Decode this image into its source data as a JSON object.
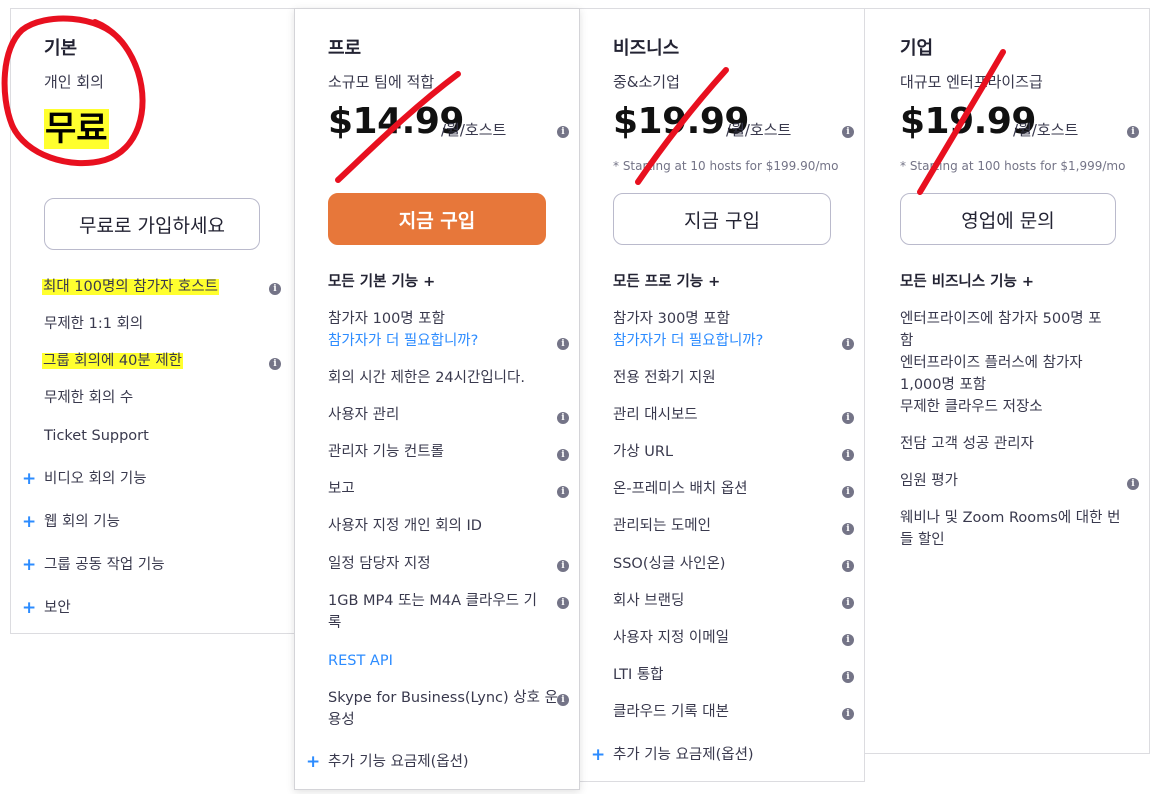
{
  "plans": [
    {
      "name": "기본",
      "subtitle": "개인 회의",
      "price": "무료",
      "cta": "무료로 가입하세요",
      "features": [
        "최대 100명의 참가자 호스트",
        "무제한 1:1 회의",
        "그룹 회의에 40분 제한",
        "무제한 회의 수",
        "Ticket Support"
      ],
      "expandables": [
        "비디오 회의 기능",
        "웹 회의 기능",
        "그룹 공동 작업 기능",
        "보안"
      ]
    },
    {
      "name": "프로",
      "subtitle": "소규모 팀에 적합",
      "price": "$14.99",
      "price_unit": "/월/호스트",
      "cta": "지금 구입",
      "section_header": "모든 기본 기능 +",
      "features": [
        "참가자 100명 포함",
        "참가자가 더 필요합니까?",
        "회의 시간 제한은 24시간입니다.",
        "사용자 관리",
        "관리자 기능 컨트롤",
        "보고",
        "사용자 지정 개인 회의 ID",
        "일정 담당자 지정",
        "1GB MP4 또는 M4A 클라우드 기",
        "록",
        "REST API",
        "Skype for Business(Lync) 상호 운",
        "용성"
      ],
      "addon": "추가 기능 요금제(옵션)"
    },
    {
      "name": "비즈니스",
      "subtitle": "중&소기업",
      "price": "$19.99",
      "price_unit": "/월/호스트",
      "starting": "* Starting at 10 hosts for $199.90/mo",
      "cta": "지금 구입",
      "section_header": "모든 프로 기능 +",
      "features": [
        "참가자 300명 포함",
        "참가자가 더 필요합니까?",
        "전용 전화기 지원",
        "관리 대시보드",
        "가상 URL",
        "온-프레미스 배치 옵션",
        "관리되는 도메인",
        "SSO(싱글 사인온)",
        "회사 브랜딩",
        "사용자 지정 이메일",
        "LTI 통합",
        "클라우드 기록 대본"
      ],
      "addon": "추가 기능 요금제(옵션)"
    },
    {
      "name": "기업",
      "subtitle": "대규모 엔터프라이즈급",
      "price": "$19.99",
      "price_unit": "/월/호스트",
      "starting": "* Starting at 100 hosts for $1,999/mo",
      "cta": "영업에 문의",
      "section_header": "모든 비즈니스 기능 +",
      "features": [
        "엔터프라이즈에 참가자 500명 포",
        "함",
        "엔터프라이즈 플러스에 참가자",
        "1,000명 포함",
        "무제한 클라우드 저장소",
        "전담 고객 성공 관리자",
        "임원 평가",
        "웨비나 및 Zoom Rooms에 대한 번",
        "들 할인"
      ]
    }
  ],
  "icons": {
    "info": "info-icon",
    "plus": "plus-icon"
  },
  "colors": {
    "primary_cta": "#e7773a",
    "link": "#2d8cff",
    "highlight": "#ffff2e",
    "annotation": "#e8101f"
  }
}
